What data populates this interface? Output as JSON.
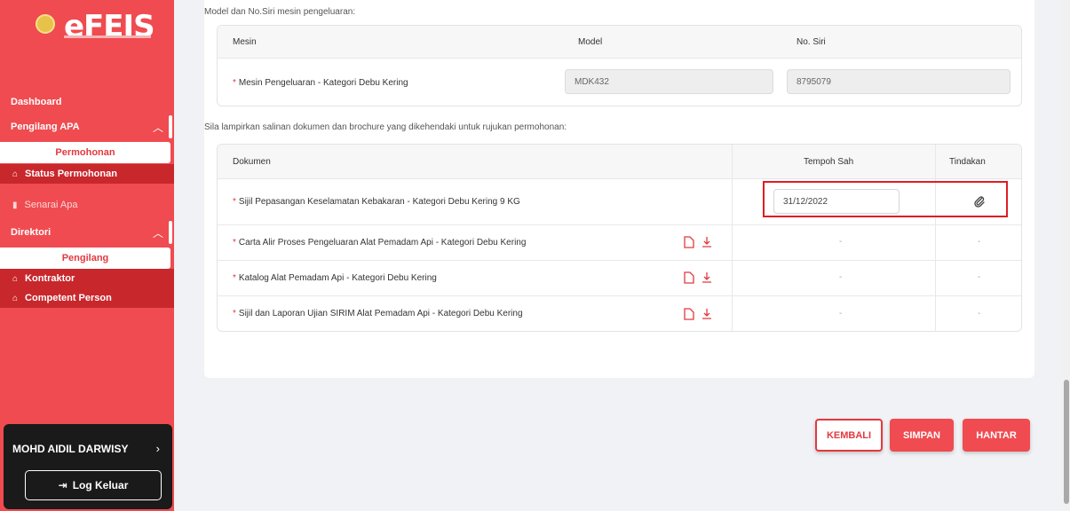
{
  "sidebar": {
    "logo_text": "eFEIS",
    "dashboard": "Dashboard",
    "group_pengilang_apa": "Pengilang APA",
    "permohonan": "Permohonan",
    "status_permohonan": "Status Permohonan",
    "senarai_apa": "Senarai Apa",
    "group_direktori": "Direktori",
    "pengilang": "Pengilang",
    "kontraktor": "Kontraktor",
    "competent_person": "Competent Person",
    "user_name": "MOHD AIDIL DARWISY",
    "logout": "Log Keluar"
  },
  "machine": {
    "caption": "Model dan No.Siri mesin pengeluaran:",
    "headers": [
      "Mesin",
      "Model",
      "No. Siri"
    ],
    "row_label": "Mesin Pengeluaran - Kategori Debu Kering",
    "model_value": "MDK432",
    "serial_value": "8795079"
  },
  "documents": {
    "caption": "Sila lampirkan salinan dokumen dan brochure yang dikehendaki untuk rujukan permohonan:",
    "headers": [
      "Dokumen",
      "Tempoh Sah",
      "Tindakan"
    ],
    "rows": [
      {
        "label": "Sijil Pepasangan Keselamatan Kebakaran - Kategori Debu Kering 9 KG",
        "tempoh": "31/12/2022",
        "tindakan": ""
      },
      {
        "label": "Carta Alir Proses Pengeluaran Alat Pemadam Api - Kategori Debu Kering",
        "tempoh": "-",
        "tindakan": "-"
      },
      {
        "label": "Katalog Alat Pemadam Api - Kategori Debu Kering",
        "tempoh": "-",
        "tindakan": "-"
      },
      {
        "label": "Sijil dan Laporan Ujian SIRIM Alat Pemadam Api - Kategori Debu Kering",
        "tempoh": "-",
        "tindakan": "-"
      }
    ]
  },
  "actions": {
    "kembali": "KEMBALI",
    "simpan": "SIMPAN",
    "hantar": "HANTAR"
  },
  "colors": {
    "brand": "#ef4b50",
    "highlight": "#e01c22"
  },
  "icons": [
    "chevron-up-icon",
    "home-icon",
    "file-icon",
    "download-icon",
    "paperclip-icon",
    "logout-icon",
    "chevron-right-icon"
  ]
}
